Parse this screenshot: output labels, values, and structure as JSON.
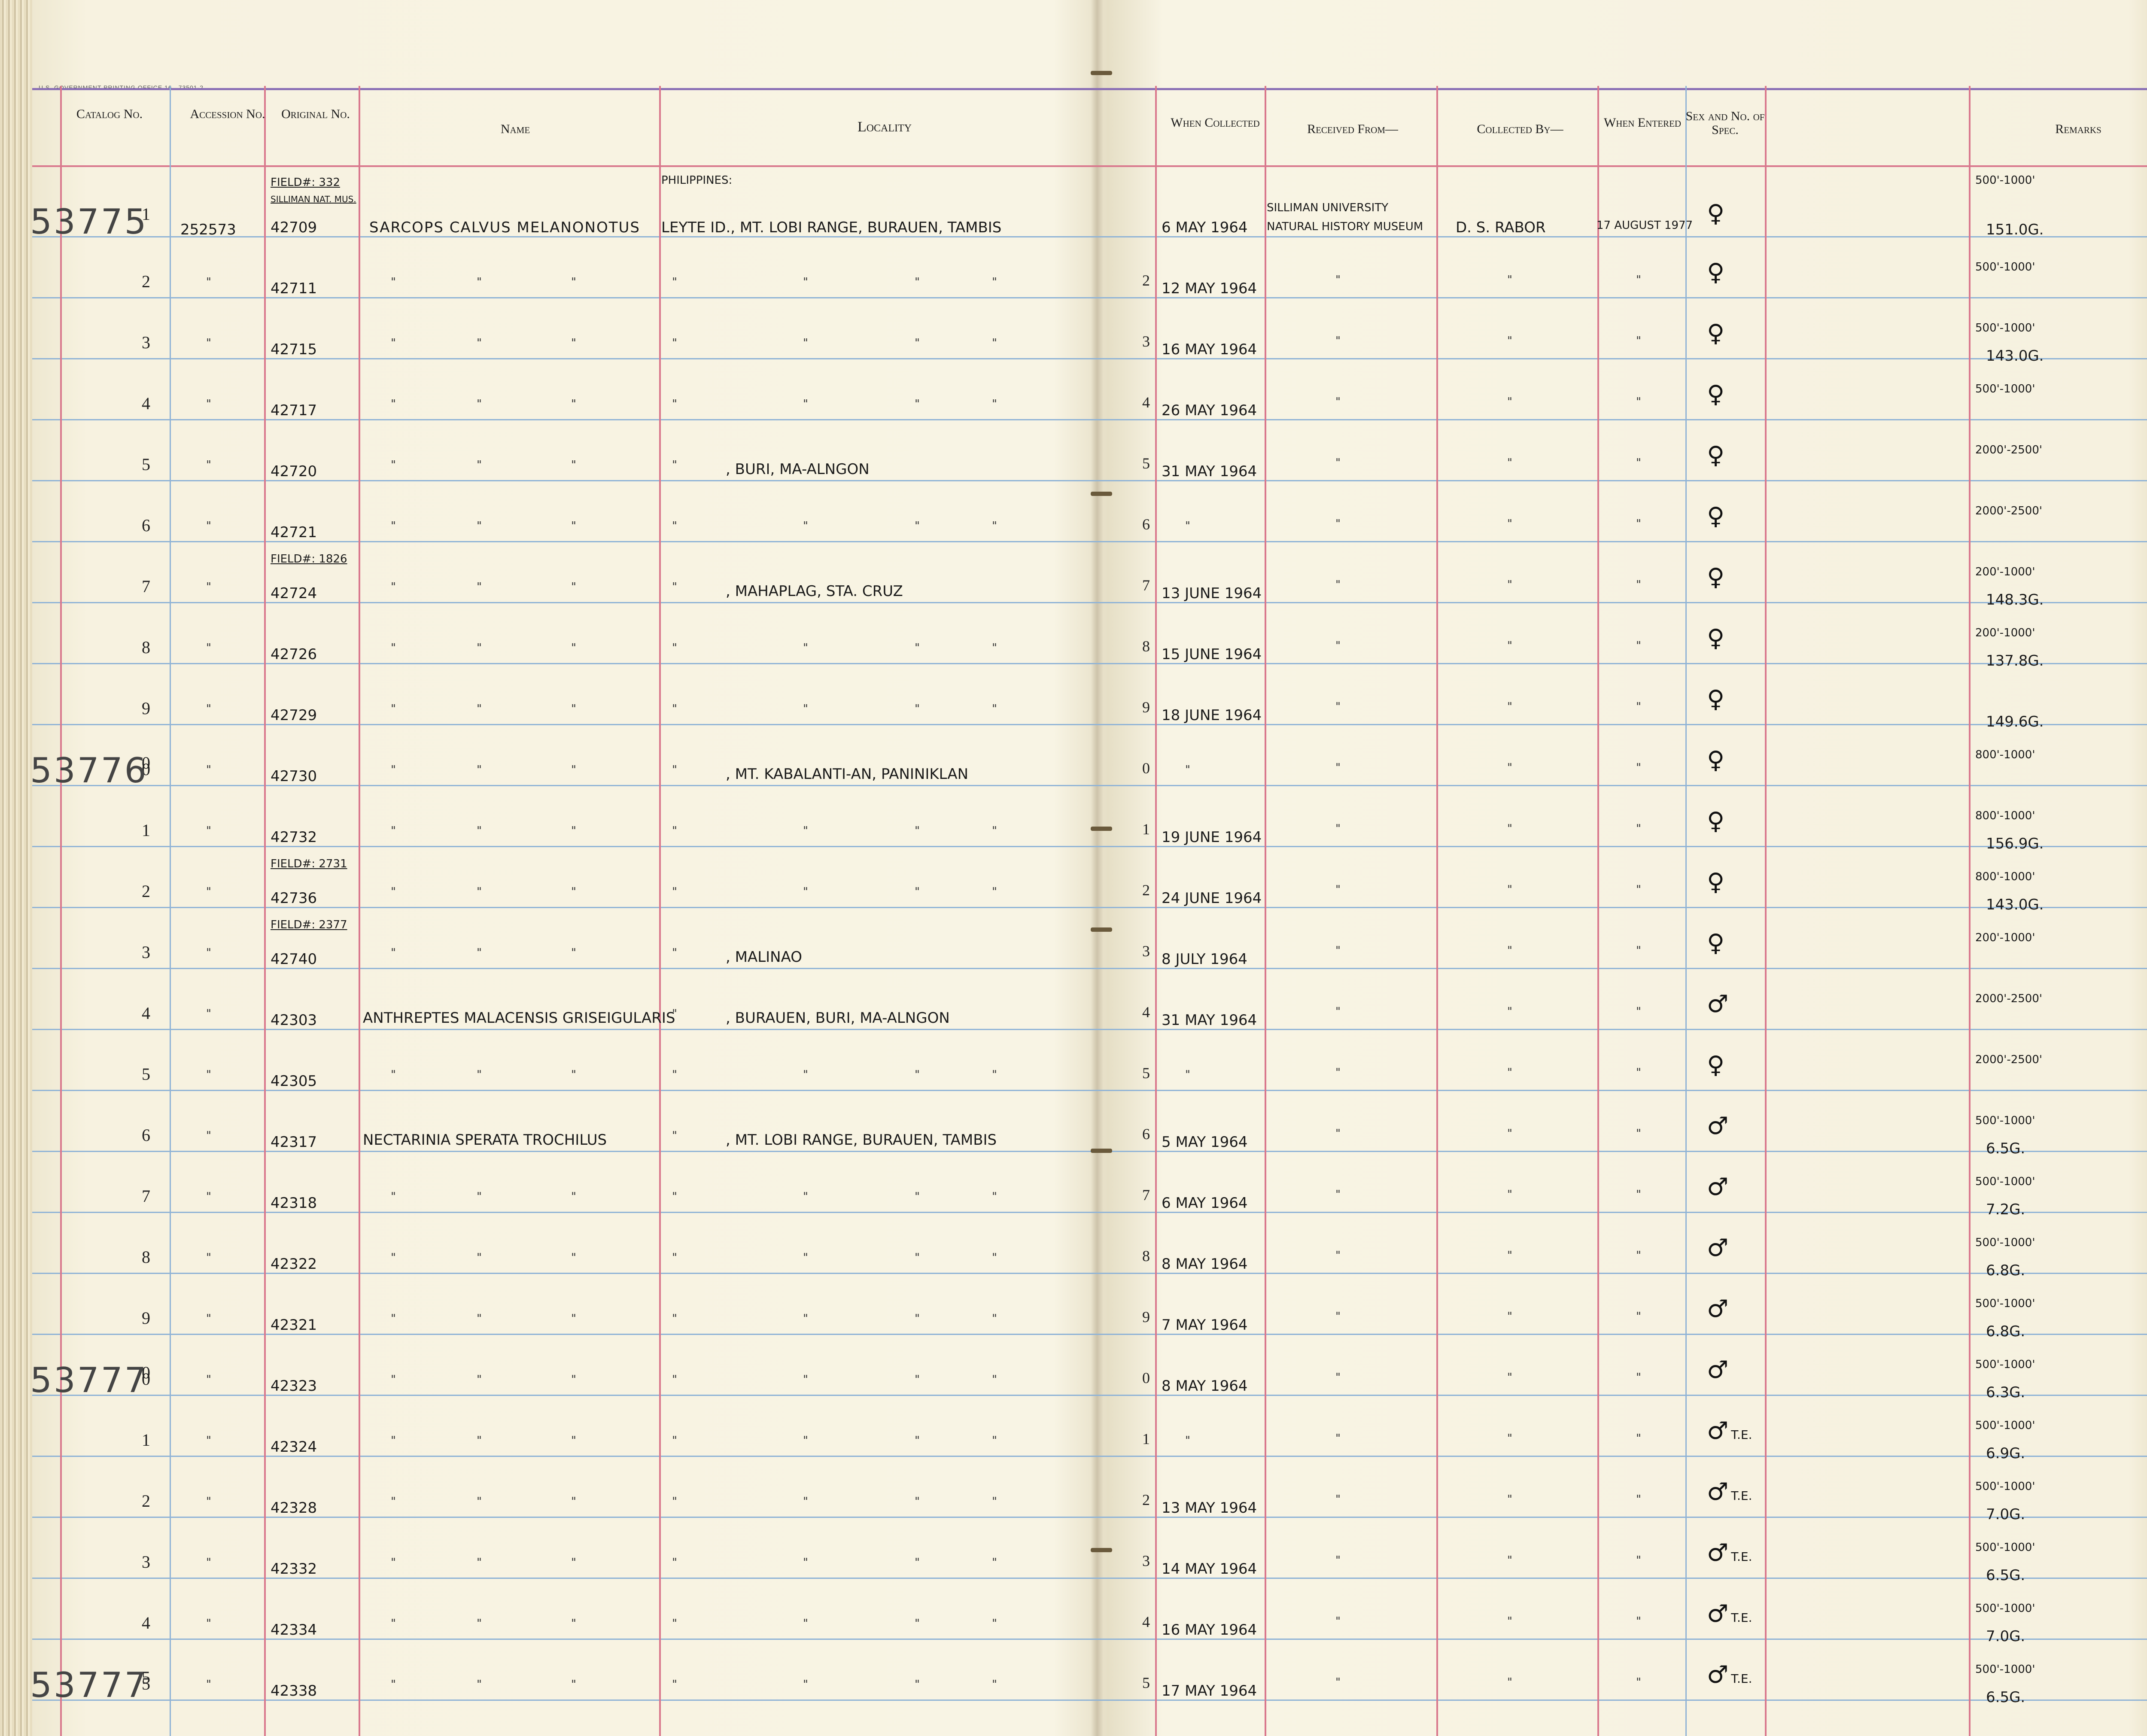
{
  "header": {
    "printer_line": "U.S. GOVERNMENT PRINTING OFFICE   16—73501-2",
    "catalog": "Catalog No.",
    "accession": "Accession No.",
    "original": "Original No.",
    "name": "Name",
    "locality": "Locality",
    "when_collected": "When Collected",
    "received_from": "Received From—",
    "collected_by": "Collected By—",
    "when_entered": "When Entered",
    "sex": "Sex and No. of Spec.",
    "remarks": "Remarks"
  },
  "catalog_blocks": [
    "537751",
    "537760",
    "537770",
    "537775"
  ],
  "first_entry": {
    "accession": "252573",
    "field_note": "FIELD#: 332",
    "museum_note": "SILLIMAN NAT. MUS.",
    "original": "42709",
    "name": "SARCOPS CALVUS MELANONOTUS",
    "country": "PHILIPPINES:",
    "locality": "LEYTE ID., MT. LOBI RANGE, BURAUEN, TAMBIS",
    "date": "6 MAY 1964",
    "received_from": "SILLIMAN UNIVERSITY NATURAL HISTORY MUSEUM",
    "collected_by": "D. S. RABOR",
    "entered": "17 AUGUST 1977",
    "sex": "♀",
    "elevation": "500'-1000'",
    "weight": "151.0G."
  },
  "rows": [
    {
      "d": "2",
      "orig": "42711",
      "loc": "",
      "date": "12 MAY 1964",
      "sex": "♀",
      "te": "",
      "elev": "500'-1000'",
      "wt": ""
    },
    {
      "d": "3",
      "orig": "42715",
      "loc": "",
      "date": "16 MAY 1964",
      "sex": "♀",
      "te": "",
      "elev": "500'-1000'",
      "wt": "143.0G."
    },
    {
      "d": "4",
      "orig": "42717",
      "loc": "",
      "date": "26 MAY 1964",
      "sex": "♀",
      "te": "",
      "elev": "500'-1000'",
      "wt": ""
    },
    {
      "d": "5",
      "orig": "42720",
      "loc": ", BURI, MA-ALNGON",
      "date": "31 MAY 1964",
      "sex": "♀",
      "te": "",
      "elev": "2000'-2500'",
      "wt": ""
    },
    {
      "d": "6",
      "orig": "42721",
      "loc": "",
      "date": "",
      "sex": "♀",
      "te": "",
      "elev": "2000'-2500'",
      "wt": ""
    },
    {
      "d": "7",
      "orig": "42724",
      "field": "FIELD#: 1826",
      "loc": ", MAHAPLAG, STA. CRUZ",
      "date": "13 JUNE 1964",
      "sex": "♀",
      "te": "",
      "elev": "200'-1000'",
      "wt": "148.3G."
    },
    {
      "d": "8",
      "orig": "42726",
      "loc": "",
      "date": "15 JUNE 1964",
      "sex": "♀",
      "te": "",
      "elev": "200'-1000'",
      "wt": "137.8G."
    },
    {
      "d": "9",
      "orig": "42729",
      "loc": "",
      "date": "18 JUNE 1964",
      "sex": "♀",
      "te": "",
      "elev": "",
      "wt": "149.6G."
    },
    {
      "d": "0",
      "orig": "42730",
      "loc": ", MT. KABALANTI-AN, PANINIKLAN",
      "date": "",
      "sex": "♀",
      "te": "",
      "elev": "800'-1000'",
      "wt": ""
    },
    {
      "d": "1",
      "orig": "42732",
      "loc": "",
      "date": "19 JUNE 1964",
      "sex": "♀",
      "te": "",
      "elev": "800'-1000'",
      "wt": "156.9G."
    },
    {
      "d": "2",
      "orig": "42736",
      "field": "FIELD#: 2731",
      "loc": "",
      "date": "24 JUNE 1964",
      "sex": "♀",
      "te": "",
      "elev": "800'-1000'",
      "wt": "143.0G."
    },
    {
      "d": "3",
      "orig": "42740",
      "field": "FIELD#: 2377",
      "loc": ", MALINAO",
      "date": "8 JULY 1964",
      "sex": "♀",
      "te": "",
      "elev": "200'-1000'",
      "wt": ""
    },
    {
      "d": "4",
      "orig": "42303",
      "name": "ANTHREPTES MALACENSIS GRISEIGULARIS",
      "loc": ", BURAUEN, BURI, MA-ALNGON",
      "date": "31 MAY 1964",
      "sex": "♂",
      "te": "",
      "elev": "2000'-2500'",
      "wt": ""
    },
    {
      "d": "5",
      "orig": "42305",
      "loc": "",
      "date": "",
      "sex": "♀",
      "te": "",
      "elev": "2000'-2500'",
      "wt": ""
    },
    {
      "d": "6",
      "orig": "42317",
      "name": "NECTARINIA SPERATA TROCHILUS",
      "loc": ", MT. LOBI RANGE, BURAUEN, TAMBIS",
      "date": "5 MAY 1964",
      "sex": "♂",
      "te": "",
      "elev": "500'-1000'",
      "wt": "6.5G."
    },
    {
      "d": "7",
      "orig": "42318",
      "loc": "",
      "date": "6 MAY 1964",
      "sex": "♂",
      "te": "",
      "elev": "500'-1000'",
      "wt": "7.2G."
    },
    {
      "d": "8",
      "orig": "42322",
      "loc": "",
      "date": "8 MAY 1964",
      "sex": "♂",
      "te": "",
      "elev": "500'-1000'",
      "wt": "6.8G."
    },
    {
      "d": "9",
      "orig": "42321",
      "loc": "",
      "date": "7 MAY 1964",
      "sex": "♂",
      "te": "",
      "elev": "500'-1000'",
      "wt": "6.8G."
    },
    {
      "d": "0",
      "orig": "42323",
      "loc": "",
      "date": "8 MAY 1964",
      "sex": "♂",
      "te": "",
      "elev": "500'-1000'",
      "wt": "6.3G."
    },
    {
      "d": "1",
      "orig": "42324",
      "loc": "",
      "date": "",
      "sex": "♂",
      "te": "T.E.",
      "elev": "500'-1000'",
      "wt": "6.9G."
    },
    {
      "d": "2",
      "orig": "42328",
      "loc": "",
      "date": "13 MAY 1964",
      "sex": "♂",
      "te": "T.E.",
      "elev": "500'-1000'",
      "wt": "7.0G."
    },
    {
      "d": "3",
      "orig": "42332",
      "loc": "",
      "date": "14 MAY 1964",
      "sex": "♂",
      "te": "T.E.",
      "elev": "500'-1000'",
      "wt": "6.5G."
    },
    {
      "d": "4",
      "orig": "42334",
      "loc": "",
      "date": "16 MAY 1964",
      "sex": "♂",
      "te": "T.E.",
      "elev": "500'-1000'",
      "wt": "7.0G."
    },
    {
      "d": "5",
      "orig": "42338",
      "loc": "",
      "date": "17 MAY 1964",
      "sex": "♂",
      "te": "T.E.",
      "elev": "500'-1000'",
      "wt": "6.5G."
    }
  ]
}
